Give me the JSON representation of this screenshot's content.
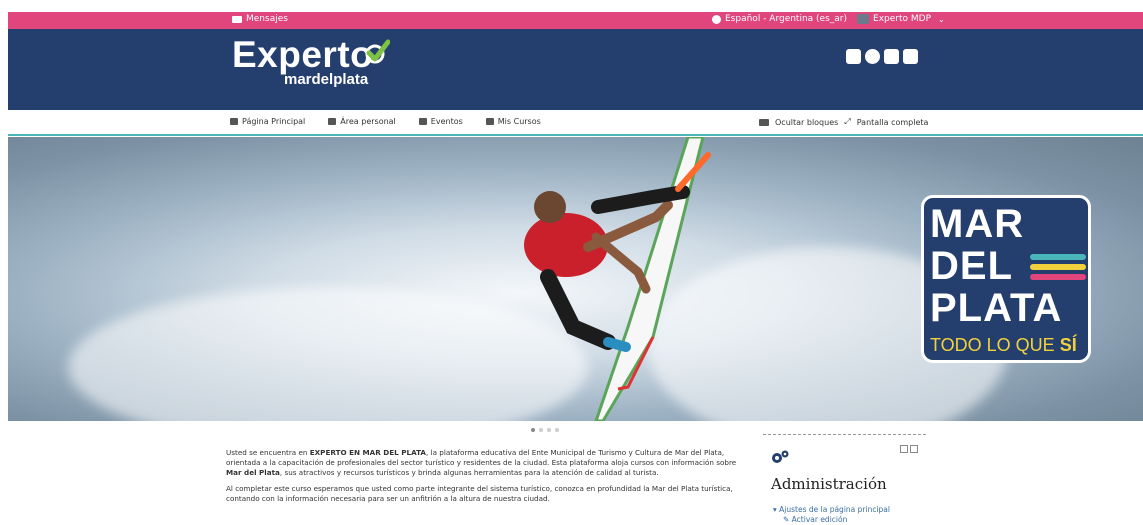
{
  "topbar": {
    "messages_label": "Mensajes",
    "language_label": "Español - Argentina (es_ar)",
    "user_label": "Experto MDP"
  },
  "header": {
    "logo_line1": "Experto",
    "logo_line2": "mardelplata",
    "social_icons": [
      "instagram-icon",
      "globe-icon",
      "facebook-icon",
      "twitter-icon"
    ]
  },
  "nav": {
    "items": [
      {
        "label": "Página Principal",
        "icon": "home-icon"
      },
      {
        "label": "Área personal",
        "icon": "dashboard-icon"
      },
      {
        "label": "Eventos",
        "icon": "calendar-icon"
      },
      {
        "label": "Mis Cursos",
        "icon": "briefcase-icon"
      }
    ],
    "hide_blocks_label": "Ocultar bloques",
    "fullscreen_label": "Pantalla completa"
  },
  "hero": {
    "badge_line1": "MAR",
    "badge_line2": "DEL",
    "badge_line3": "PLATA",
    "badge_tag_main": "TODO LO QUE ",
    "badge_tag_emph": "SÍ",
    "carousel_pages": 4,
    "carousel_active": 1
  },
  "content": {
    "p1_pre": "Usted se encuentra en ",
    "p1_bold1": "EXPERTO EN MAR DEL PLATA",
    "p1_mid": ", la plataforma educativa del Ente Municipal de Turismo y Cultura de Mar del Plata, orientada a la capacitación de profesionales del sector turístico y residentes de la ciudad. Esta plataforma aloja cursos con información sobre ",
    "p1_bold2": "Mar del Plata",
    "p1_post": ", sus atractivos y recursos turísticos y brinda algunas herramientas para la atención de calidad al turista.",
    "p2_pre": "Al completar este curso esperamos que usted como parte integrante del sistema turístico, conozca en profundidad la Mar del Plata turística, contando con la información necesaria para ser un anfitrión a la altura de nuestra ciudad."
  },
  "sidebar": {
    "title": "Administración",
    "link1": "Ajustes de la página principal",
    "link2": "Activar edición"
  },
  "colors": {
    "topbar": "#e0457b",
    "header": "#243e6e",
    "accent_teal": "#4ab6ba",
    "logo_check": "#7dc242"
  }
}
